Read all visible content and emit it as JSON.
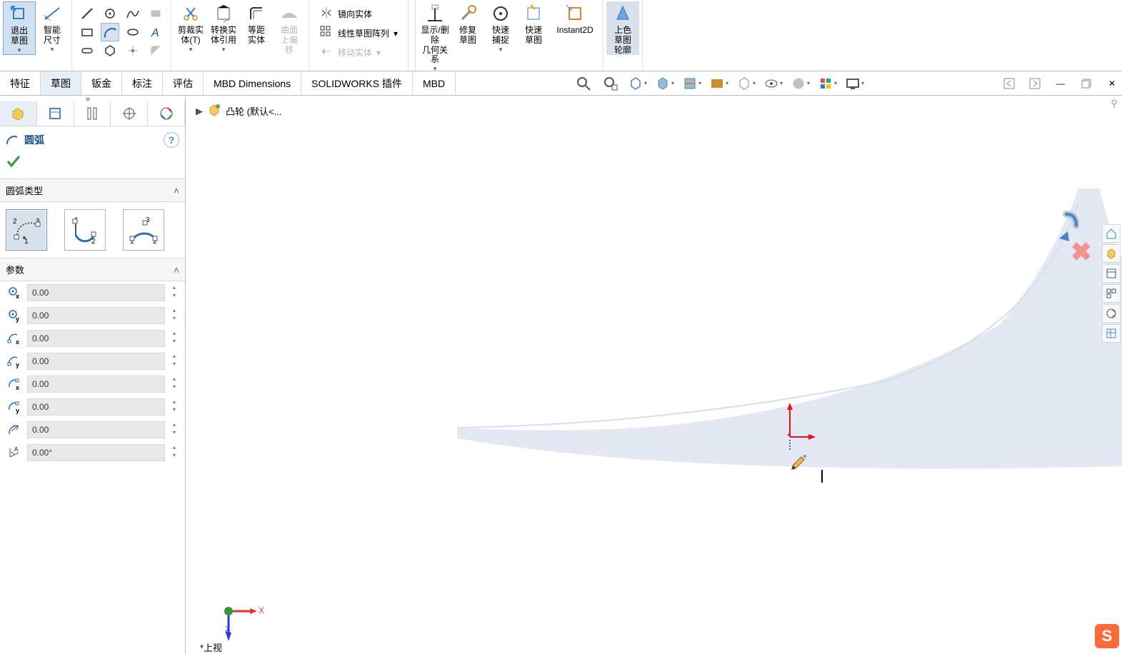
{
  "ribbon": {
    "exit_sketch": "退出\n草图",
    "smart_dim": "智能\n尺寸",
    "trim": "剪裁实\n体(T)",
    "convert": "转换实\n体引用",
    "offset": "等距\n实体",
    "surf_offset": "曲面\n上偏\n移",
    "mirror": "镜向实体",
    "linear_pattern": "线性草图阵列",
    "move": "移动实体",
    "show_rel": "显示/删除\n几何关系",
    "repair": "修复\n草图",
    "quick_snap": "快速\n捕捉",
    "quick_sketch": "快速\n草图",
    "instant2d": "Instant2D",
    "shade_contour": "上色\n草图\n轮廓"
  },
  "tabs": {
    "feature": "特征",
    "sketch": "草图",
    "sheet": "钣金",
    "annot": "标注",
    "eval": "评估",
    "mbd_dim": "MBD Dimensions",
    "sw_addin": "SOLIDWORKS 插件",
    "mbd": "MBD"
  },
  "pm": {
    "title": "圆弧",
    "help": "?",
    "arc_type_label": "圆弧类型",
    "params_label": "参数",
    "cx": "0.00",
    "cy": "0.00",
    "sx": "0.00",
    "sy": "0.00",
    "ex": "0.00",
    "ey": "0.00",
    "r": "0.00",
    "a": "0.00°"
  },
  "crumb": {
    "part": "凸轮  (默认<..."
  },
  "triad": {
    "x": "X",
    "z": "Z",
    "label": "*上视"
  },
  "sogou": "S"
}
